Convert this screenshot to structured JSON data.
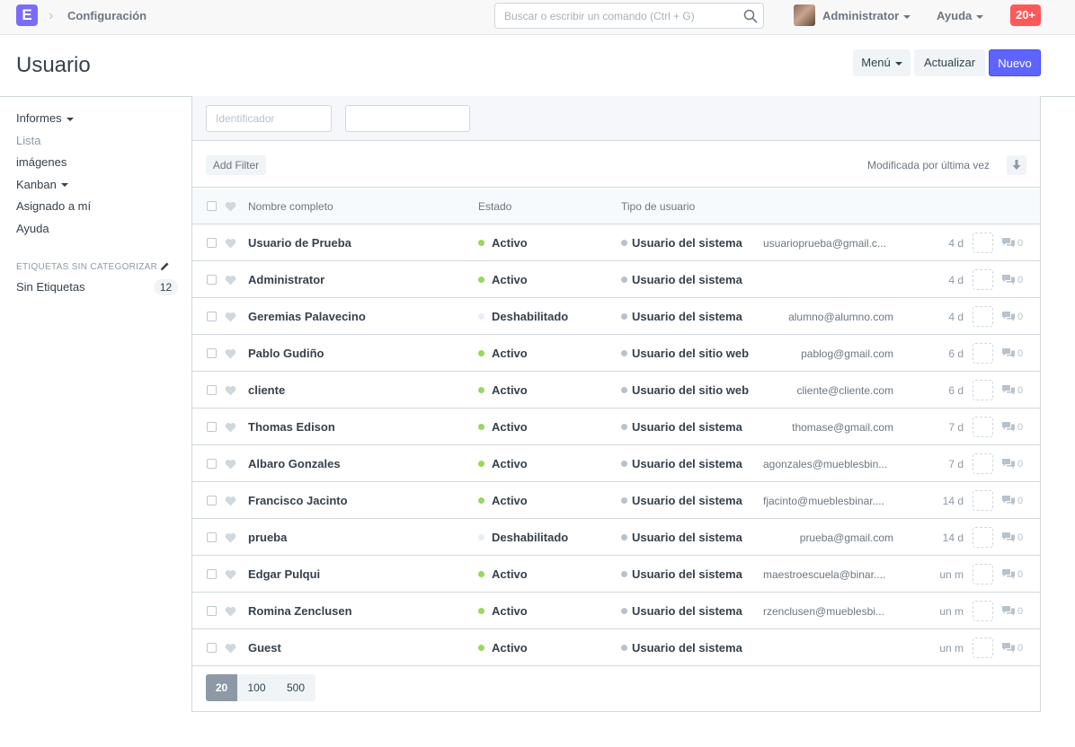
{
  "navbar": {
    "logo": "E",
    "breadcrumb": "Configuración",
    "search_placeholder": "Buscar o escribir un comando (Ctrl + G)",
    "user": "Administrator",
    "help": "Ayuda",
    "notifications": "20+"
  },
  "page": {
    "title": "Usuario",
    "menu_btn": "Menú",
    "refresh_btn": "Actualizar",
    "new_btn": "Nuevo"
  },
  "sidebar": {
    "items": [
      {
        "label": "Informes"
      },
      {
        "label": "Lista"
      },
      {
        "label": "imágenes"
      },
      {
        "label": "Kanban"
      },
      {
        "label": "Asignado a mí"
      },
      {
        "label": "Ayuda"
      }
    ],
    "tags_title": "ETIQUETAS SIN CATEGORIZAR",
    "tag_label": "Sin Etiquetas",
    "tag_count": "12"
  },
  "filters": {
    "id_placeholder": "Identificador",
    "add_filter": "Add Filter",
    "sort_label": "Modificada por última vez"
  },
  "columns": {
    "name": "Nombre completo",
    "status": "Estado",
    "type": "Tipo de usuario"
  },
  "colors": {
    "active": "#98d85b",
    "disabled": "#ebeef0",
    "type_dot": "#b8c2cc",
    "primary": "#5e64ff",
    "notif": "#ff5858"
  },
  "rows": [
    {
      "name": "Usuario de Prueba",
      "status": "Activo",
      "type": "Usuario del sistema",
      "email": "usuarioprueba@gmail.c...",
      "modified": "4 d",
      "comments": "0"
    },
    {
      "name": "Administrator",
      "status": "Activo",
      "type": "Usuario del sistema",
      "email": "",
      "modified": "4 d",
      "comments": "0"
    },
    {
      "name": "Geremias Palavecino",
      "status": "Deshabilitado",
      "type": "Usuario del sistema",
      "email": "alumno@alumno.com",
      "modified": "4 d",
      "comments": "0"
    },
    {
      "name": "Pablo Gudiño",
      "status": "Activo",
      "type": "Usuario del sitio web",
      "email": "pablog@gmail.com",
      "modified": "6 d",
      "comments": "0"
    },
    {
      "name": "cliente",
      "status": "Activo",
      "type": "Usuario del sitio web",
      "email": "cliente@cliente.com",
      "modified": "6 d",
      "comments": "0"
    },
    {
      "name": "Thomas Edison",
      "status": "Activo",
      "type": "Usuario del sistema",
      "email": "thomase@gmail.com",
      "modified": "7 d",
      "comments": "0"
    },
    {
      "name": "Albaro Gonzales",
      "status": "Activo",
      "type": "Usuario del sistema",
      "email": "agonzales@mueblesbin...",
      "modified": "7 d",
      "comments": "0"
    },
    {
      "name": "Francisco Jacinto",
      "status": "Activo",
      "type": "Usuario del sistema",
      "email": "fjacinto@mueblesbinar....",
      "modified": "14 d",
      "comments": "0"
    },
    {
      "name": "prueba",
      "status": "Deshabilitado",
      "type": "Usuario del sistema",
      "email": "prueba@gmail.com",
      "modified": "14 d",
      "comments": "0"
    },
    {
      "name": "Edgar Pulqui",
      "status": "Activo",
      "type": "Usuario del sistema",
      "email": "maestroescuela@binar....",
      "modified": "un m",
      "comments": "0"
    },
    {
      "name": "Romina Zenclusen",
      "status": "Activo",
      "type": "Usuario del sistema",
      "email": "rzenclusen@mueblesbi...",
      "modified": "un m",
      "comments": "0"
    },
    {
      "name": "Guest",
      "status": "Activo",
      "type": "Usuario del sistema",
      "email": "",
      "modified": "un m",
      "comments": "0"
    }
  ],
  "paging": [
    "20",
    "100",
    "500"
  ]
}
